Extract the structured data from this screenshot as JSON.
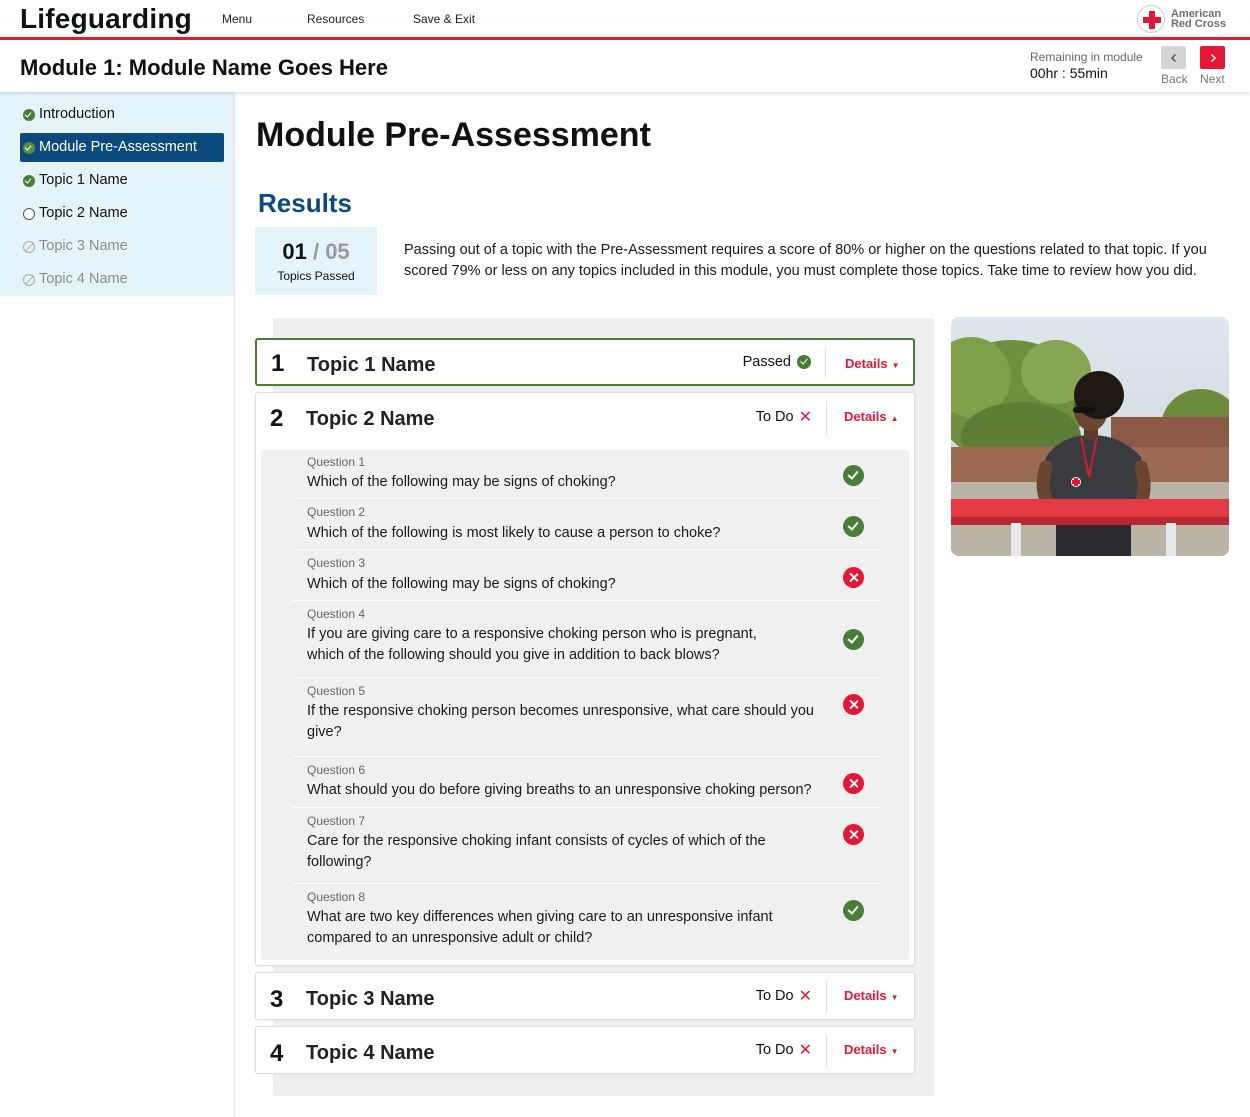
{
  "app": {
    "brand": "Lifeguarding",
    "nav": [
      "Menu",
      "Resources",
      "Save & Exit"
    ],
    "logo_line1": "American",
    "logo_line2": "Red Cross"
  },
  "module": {
    "title": "Module 1: Module Name Goes Here",
    "remaining_label": "Remaining in module",
    "remaining_time": "00hr : 55min",
    "back_label": "Back",
    "next_label": "Next"
  },
  "sidebar": {
    "items": [
      {
        "label": "Introduction",
        "state": "done"
      },
      {
        "label": "Module Pre-Assessment",
        "state": "done-active"
      },
      {
        "label": "Topic 1 Name",
        "state": "done"
      },
      {
        "label": "Topic 2 Name",
        "state": "open"
      },
      {
        "label": "Topic 3 Name",
        "state": "locked"
      },
      {
        "label": "Topic 4 Name",
        "state": "locked"
      }
    ]
  },
  "main": {
    "page_title": "Module Pre-Assessment",
    "results_title": "Results",
    "score": {
      "passed": "01",
      "separator": "/",
      "total": "05",
      "label": "Topics Passed"
    },
    "results_text": "Passing out of a topic with the Pre-Assessment requires a score of 80% or higher on the questions related to that topic. If you scored 79% or less on any topics included in this module, you must complete those topics. Take time to review how you did.",
    "details_label": "Details",
    "topics": [
      {
        "number": "1",
        "name": "Topic 1 Name",
        "status": "Passed"
      },
      {
        "number": "2",
        "name": "Topic 2 Name",
        "status": "To Do"
      },
      {
        "number": "3",
        "name": "Topic 3 Name",
        "status": "To Do"
      },
      {
        "number": "4",
        "name": "Topic 4 Name",
        "status": "To Do"
      }
    ],
    "questions": [
      {
        "label": "Question 1",
        "text": "Which of the following may be signs of choking?",
        "result": "correct"
      },
      {
        "label": "Question 2",
        "text": "Which of the following is most likely to cause a person to choke?",
        "result": "correct"
      },
      {
        "label": "Question 3",
        "text": "Which of the following may be signs of choking?",
        "result": "incorrect"
      },
      {
        "label": "Question 4",
        "text": "If you are giving care to a responsive choking person who is pregnant, which of the following should you give in addition to back blows?",
        "result": "correct"
      },
      {
        "label": "Question 5",
        "text": "If the responsive choking person becomes unresponsive, what care should you give?",
        "result": "incorrect"
      },
      {
        "label": "Question 6",
        "text": "What should you do before giving breaths to an unresponsive choking person?",
        "result": "incorrect"
      },
      {
        "label": "Question 7",
        "text": "Care for the responsive choking infant consists of cycles of which of the following?",
        "result": "incorrect"
      },
      {
        "label": "Question 8",
        "text": "What are two key differences when giving care to an unresponsive infant compared to an unresponsive adult or child?",
        "result": "correct"
      }
    ]
  },
  "colors": {
    "brand_red": "#e31837",
    "nav_blue": "#0b4a7d",
    "pass_green": "#4a7c3a",
    "sidebar_bg": "#e5f4fb"
  }
}
